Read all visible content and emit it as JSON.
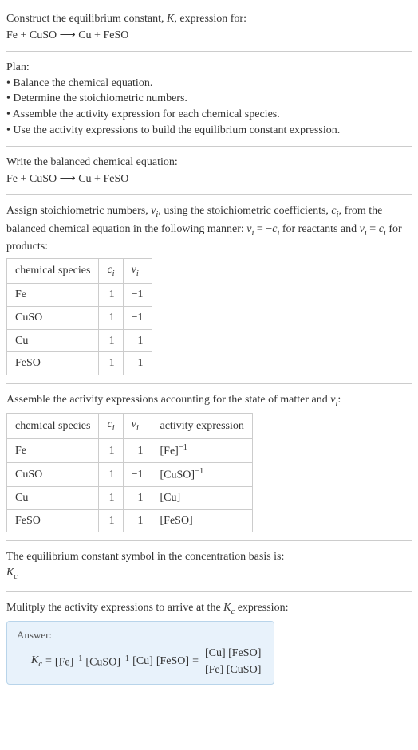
{
  "intro": {
    "title_part1": "Construct the equilibrium constant, ",
    "title_K": "K",
    "title_part2": ", expression for:",
    "equation_lhs": "Fe + CuSO",
    "equation_arrow": "⟶",
    "equation_rhs": "Cu + FeSO"
  },
  "plan": {
    "heading": "Plan:",
    "items": [
      "• Balance the chemical equation.",
      "• Determine the stoichiometric numbers.",
      "• Assemble the activity expression for each chemical species.",
      "• Use the activity expressions to build the equilibrium constant expression."
    ]
  },
  "balanced": {
    "heading": "Write the balanced chemical equation:",
    "equation_lhs": "Fe + CuSO",
    "equation_arrow": "⟶",
    "equation_rhs": "Cu + FeSO"
  },
  "stoich": {
    "text_part1": "Assign stoichiometric numbers, ",
    "nu_i": "ν",
    "nu_sub": "i",
    "text_part2": ", using the stoichiometric coefficients, ",
    "c_i": "c",
    "c_sub": "i",
    "text_part3": ", from the balanced chemical equation in the following manner: ",
    "rel1_lhs": "ν",
    "rel1_eq": " = −",
    "rel1_rhs": "c",
    "text_part4": " for reactants and ",
    "rel2_lhs": "ν",
    "rel2_eq": " = ",
    "rel2_rhs": "c",
    "text_part5": " for products:",
    "table": {
      "headers": [
        "chemical species",
        "cᵢ",
        "νᵢ"
      ],
      "rows": [
        {
          "species": "Fe",
          "c": "1",
          "nu": "−1"
        },
        {
          "species": "CuSO",
          "c": "1",
          "nu": "−1"
        },
        {
          "species": "Cu",
          "c": "1",
          "nu": "1"
        },
        {
          "species": "FeSO",
          "c": "1",
          "nu": "1"
        }
      ]
    }
  },
  "activity": {
    "heading_part1": "Assemble the activity expressions accounting for the state of matter and ",
    "nu": "ν",
    "nu_sub": "i",
    "heading_part2": ":",
    "table": {
      "headers": [
        "chemical species",
        "cᵢ",
        "νᵢ",
        "activity expression"
      ],
      "rows": [
        {
          "species": "Fe",
          "c": "1",
          "nu": "−1",
          "expr_base": "[Fe]",
          "expr_sup": "−1"
        },
        {
          "species": "CuSO",
          "c": "1",
          "nu": "−1",
          "expr_base": "[CuSO]",
          "expr_sup": "−1"
        },
        {
          "species": "Cu",
          "c": "1",
          "nu": "1",
          "expr_base": "[Cu]",
          "expr_sup": ""
        },
        {
          "species": "FeSO",
          "c": "1",
          "nu": "1",
          "expr_base": "[FeSO]",
          "expr_sup": ""
        }
      ]
    }
  },
  "symbol": {
    "heading": "The equilibrium constant symbol in the concentration basis is:",
    "K": "K",
    "sub": "c"
  },
  "multiply": {
    "heading_part1": "Mulitply the activity expressions to arrive at the ",
    "K": "K",
    "sub": "c",
    "heading_part2": " expression:"
  },
  "answer": {
    "label": "Answer:",
    "Kc_K": "K",
    "Kc_sub": "c",
    "eq": " = ",
    "term1_base": "[Fe]",
    "term1_sup": "−1",
    "term2_base": "[CuSO]",
    "term2_sup": "−1",
    "term3": "[Cu]",
    "term4": "[FeSO]",
    "eq2": " = ",
    "frac_num": "[Cu] [FeSO]",
    "frac_den": "[Fe] [CuSO]"
  },
  "chart_data": {
    "type": "table",
    "tables": [
      {
        "title": "Stoichiometric numbers",
        "columns": [
          "chemical species",
          "c_i",
          "nu_i"
        ],
        "rows": [
          [
            "Fe",
            1,
            -1
          ],
          [
            "CuSO",
            1,
            -1
          ],
          [
            "Cu",
            1,
            1
          ],
          [
            "FeSO",
            1,
            1
          ]
        ]
      },
      {
        "title": "Activity expressions",
        "columns": [
          "chemical species",
          "c_i",
          "nu_i",
          "activity expression"
        ],
        "rows": [
          [
            "Fe",
            1,
            -1,
            "[Fe]^-1"
          ],
          [
            "CuSO",
            1,
            -1,
            "[CuSO]^-1"
          ],
          [
            "Cu",
            1,
            1,
            "[Cu]"
          ],
          [
            "FeSO",
            1,
            1,
            "[FeSO]"
          ]
        ]
      }
    ]
  }
}
